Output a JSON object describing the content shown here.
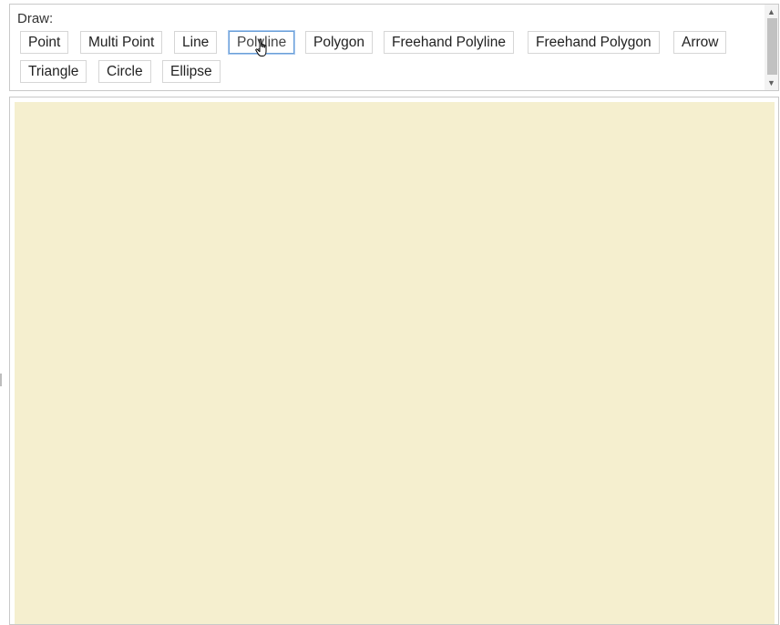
{
  "toolbar": {
    "label": "Draw:",
    "buttons": [
      {
        "label": "Point"
      },
      {
        "label": "Multi Point"
      },
      {
        "label": "Line"
      },
      {
        "label": "Polyline"
      },
      {
        "label": "Polygon"
      },
      {
        "label": "Freehand Polyline"
      },
      {
        "label": "Freehand Polygon"
      },
      {
        "label": "Arrow"
      },
      {
        "label": "Triangle"
      },
      {
        "label": "Circle"
      },
      {
        "label": "Ellipse"
      }
    ],
    "focused": "Polyline"
  },
  "icons": {
    "scroll_up": "scroll-up-arrow-icon",
    "scroll_down": "scroll-down-arrow-icon",
    "cursor": "hand-pointer-cursor-icon"
  },
  "colors": {
    "canvas_background": "#f5efcf",
    "focus_border": "#6a9fd8"
  }
}
